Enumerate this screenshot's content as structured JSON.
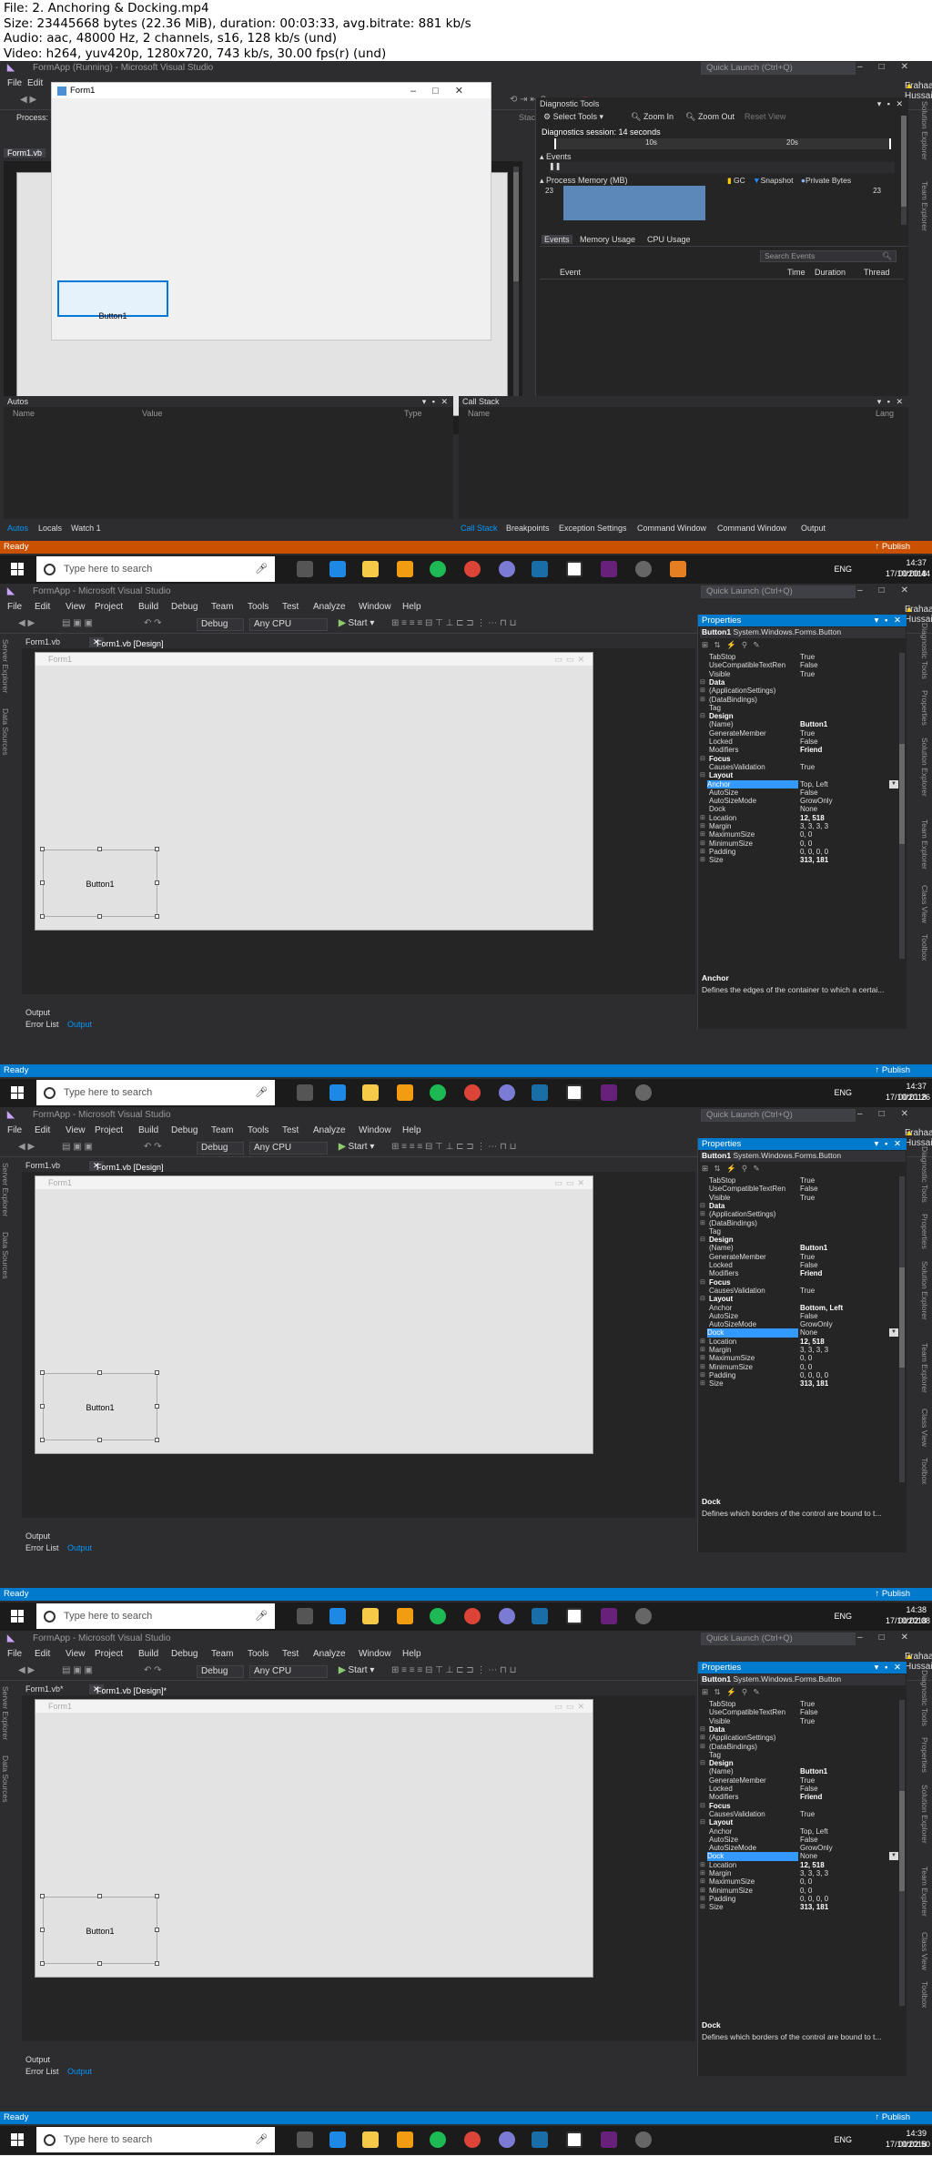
{
  "header": {
    "lines": [
      "File: 2. Anchoring & Docking.mp4",
      "Size: 23445668 bytes (22.36 MiB), duration: 00:03:33, avg.bitrate: 881 kb/s",
      "Audio: aac, 48000 Hz, 2 channels, s16, 128 kb/s (und)",
      "Video: h264, yuv420p, 1280x720, 743 kb/s, 30.00 fps(r) (und)"
    ]
  },
  "vs": {
    "title_running": "FormApp (Running) - Microsoft Visual Studio",
    "title": "FormApp - Microsoft Visual Studio",
    "quick_launch": "Quick Launch (Ctrl+Q)",
    "user": "Frahaan Hussain",
    "menu": [
      "File",
      "Edit",
      "View",
      "Project",
      "Build",
      "Debug",
      "Team",
      "Tools",
      "Test",
      "Analyze",
      "Window",
      "Help"
    ],
    "debug_config": "Debug",
    "platform": "Any CPU",
    "start": "Start",
    "process_label": "Process:",
    "stack_frame": "Stack Frame:",
    "publish": "Publish",
    "status_ready": "Ready",
    "side_left": [
      "Server Explorer",
      "Data Sources"
    ],
    "side_right": [
      "Diagnostic Tools",
      "Properties",
      "Solution Explorer",
      "Team Explorer",
      "Class View",
      "Toolbox"
    ],
    "side_right_f1": [
      "Solution Explorer",
      "Team Explorer"
    ]
  },
  "frame1": {
    "running_form_title": "Form1",
    "button_text": "Button1",
    "doc_tab": "Form1.vb",
    "diag_title": "Diagnostic Tools",
    "select_tools": "Select Tools",
    "zoom_in": "Zoom In",
    "zoom_out": "Zoom Out",
    "reset_view": "Reset View",
    "session": "Diagnostics session: 14 seconds",
    "tick_10s": "10s",
    "tick_20s": "20s",
    "events": "Events",
    "process_memory": "Process Memory (MB)",
    "gc": "GC",
    "snapshot": "Snapshot",
    "private_bytes": "Private Bytes",
    "mem_val": "23",
    "tabs": [
      "Events",
      "Memory Usage",
      "CPU Usage"
    ],
    "search_events": "Search Events",
    "ev_cols": [
      "Event",
      "Time",
      "Duration",
      "Thread"
    ],
    "autos_title": "Autos",
    "autos_cols": [
      "Name",
      "Value",
      "Type"
    ],
    "callstack_title": "Call Stack",
    "callstack_cols": [
      "Name",
      "Lang"
    ],
    "bottom_left_tabs": [
      "Autos",
      "Locals",
      "Watch 1"
    ],
    "bottom_right_tabs": [
      "Call Stack",
      "Breakpoints",
      "Exception Settings",
      "Command Window",
      "Command Window",
      "Output"
    ]
  },
  "designer_tabs": {
    "f2": [
      "Form1.vb",
      "Form1.vb [Design]"
    ],
    "f3": [
      "Form1.vb",
      "Form1.vb [Design]"
    ],
    "f4": [
      "Form1.vb*",
      "Form1.vb [Design]*"
    ]
  },
  "form_title": "Form1",
  "output_title": "Output",
  "bottom_tabs": [
    "Error List",
    "Output"
  ],
  "properties": {
    "title": "Properties",
    "object_name": "Button1",
    "object_type": "System.Windows.Forms.Button"
  },
  "prop_rows": [
    {
      "k": "TabStop",
      "v": "True"
    },
    {
      "k": "UseCompatibleTextRen",
      "v": "False"
    },
    {
      "k": "Visible",
      "v": "True"
    },
    {
      "k": "Data",
      "v": "",
      "cat": true
    },
    {
      "k": "(ApplicationSettings)",
      "v": "",
      "exp": true
    },
    {
      "k": "(DataBindings)",
      "v": "",
      "exp": true
    },
    {
      "k": "Tag",
      "v": ""
    },
    {
      "k": "Design",
      "v": "",
      "cat": true
    },
    {
      "k": "(Name)",
      "v": "Button1",
      "bold": true
    },
    {
      "k": "GenerateMember",
      "v": "True"
    },
    {
      "k": "Locked",
      "v": "False"
    },
    {
      "k": "Modifiers",
      "v": "Friend",
      "bold": true
    },
    {
      "k": "Focus",
      "v": "",
      "cat": true
    },
    {
      "k": "CausesValidation",
      "v": "True"
    },
    {
      "k": "Layout",
      "v": "",
      "cat": true
    },
    {
      "k": "Anchor",
      "v": "Top, Left"
    },
    {
      "k": "AutoSize",
      "v": "False"
    },
    {
      "k": "AutoSizeMode",
      "v": "GrowOnly"
    },
    {
      "k": "Dock",
      "v": "None"
    },
    {
      "k": "Location",
      "v": "12, 518",
      "bold": true,
      "exp": true
    },
    {
      "k": "Margin",
      "v": "3, 3, 3, 3",
      "exp": true
    },
    {
      "k": "MaximumSize",
      "v": "0, 0",
      "exp": true
    },
    {
      "k": "MinimumSize",
      "v": "0, 0",
      "exp": true
    },
    {
      "k": "Padding",
      "v": "0, 0, 0, 0",
      "exp": true
    },
    {
      "k": "Size",
      "v": "313, 181",
      "bold": true,
      "exp": true
    }
  ],
  "anchor_value_f3": "Bottom, Left",
  "desc": {
    "anchor_title": "Anchor",
    "anchor_text": "Defines the edges of the container to which a certai...",
    "dock_title": "Dock",
    "dock_text": "Defines which borders of the control are bound to t..."
  },
  "taskbar": {
    "search": "Type here to search",
    "lang": "ENG",
    "times": [
      "14:37",
      "14:37",
      "14:38",
      "14:39"
    ],
    "date": "17/10/2018",
    "timestamps": [
      "00:00:44",
      "00:01:26",
      "00:02:08",
      "00:02:50"
    ]
  }
}
